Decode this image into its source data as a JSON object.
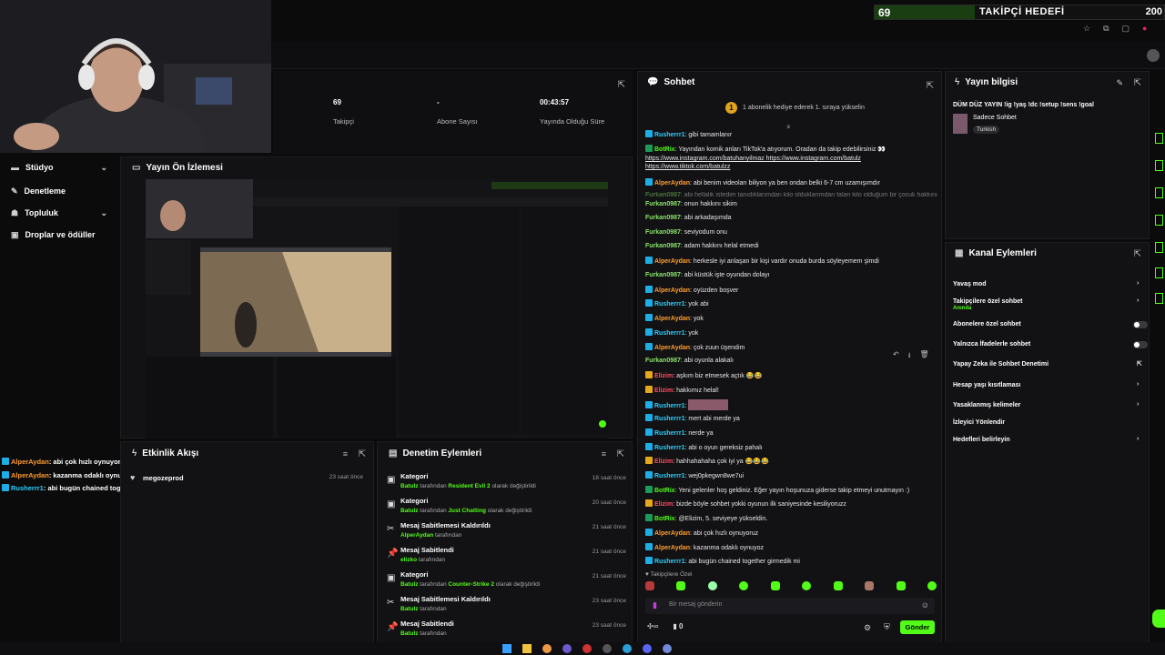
{
  "goal": {
    "current": "69",
    "label": "TAKİPÇİ HEDEFİ",
    "target": "200",
    "progress": 0.345
  },
  "sidebar": {
    "items": [
      {
        "label": "Stüdyo",
        "icon": "studio-icon",
        "has_chevron": true
      },
      {
        "label": "Denetleme",
        "icon": "wrench-icon",
        "has_chevron": false
      },
      {
        "label": "Topluluk",
        "icon": "community-icon",
        "has_chevron": true
      },
      {
        "label": "Droplar ve ödüller",
        "icon": "drops-icon",
        "has_chevron": false
      }
    ]
  },
  "stats": [
    {
      "value": "69",
      "label": "Takipçi"
    },
    {
      "value": "-",
      "label": "Abone Sayısı"
    },
    {
      "value": "00:43:57",
      "label": "Yayında Olduğu Süre"
    }
  ],
  "preview": {
    "title": "Yayın Ön İzlemesi"
  },
  "activity": {
    "title": "Etkinlik Akışı",
    "items": [
      {
        "name": "megozeprod",
        "time": "23 saat önce"
      }
    ]
  },
  "modactions": {
    "title": "Denetim Eylemleri",
    "items": [
      {
        "title": "Kategori",
        "by": "Batulz",
        "mid": " tarafından ",
        "hl": "Resident Evil 2",
        "tail": " olarak değiştirildi",
        "time": "18 saat önce",
        "icon": "category-icon"
      },
      {
        "title": "Kategori",
        "by": "Batulz",
        "mid": " tarafından ",
        "hl": "Just Chatting",
        "tail": " olarak değiştirildi",
        "time": "20 saat önce",
        "icon": "category-icon"
      },
      {
        "title": "Mesaj Sabitlemesi Kaldırıldı",
        "by": "AlperAydan",
        "mid": " tarafından",
        "hl": "",
        "tail": "",
        "time": "21 saat önce",
        "icon": "unpin-icon"
      },
      {
        "title": "Mesaj Sabitlendi",
        "by": "elizko",
        "mid": " tarafından",
        "hl": "",
        "tail": "",
        "time": "21 saat önce",
        "icon": "pin-icon"
      },
      {
        "title": "Kategori",
        "by": "Batulz",
        "mid": " tarafından ",
        "hl": "Counter-Strike 2",
        "tail": " olarak değiştirildi",
        "time": "21 saat önce",
        "icon": "category-icon"
      },
      {
        "title": "Mesaj Sabitlemesi Kaldırıldı",
        "by": "Batulz",
        "mid": " tarafından",
        "hl": "",
        "tail": "",
        "time": "23 saat önce",
        "icon": "unpin-icon"
      },
      {
        "title": "Mesaj Sabitlendi",
        "by": "Batulz",
        "mid": " tarafından",
        "hl": "",
        "tail": "",
        "time": "23 saat önce",
        "icon": "pin-icon"
      }
    ]
  },
  "chat": {
    "title": "Sohbet",
    "banner": "1 abonelik hediye ederek 1. sıraya yükselin",
    "banner_num": "1",
    "messages": [
      {
        "u": "Rusherrr1",
        "c": "u-c",
        "b": "b-mod",
        "t": ": gibi tamamlanır"
      },
      {
        "u": "BotRix",
        "c": "u-g",
        "b": "b-bot",
        "t": ": Yayından komik anları TikTok'a atıyorum. Oradan da takip edebilirsiniz 👀"
      },
      {
        "u": "",
        "c": "",
        "b": "",
        "t": "https://www.instagram.com/batuhanyilmaz https://www.instagram.com/batulz"
      },
      {
        "u": "",
        "c": "",
        "b": "",
        "t": "https://www.tiktok.com/batulzz"
      },
      {
        "u": "AlperAydan",
        "c": "u-o",
        "b": "b-mod",
        "t": ": abi benim videoları biliyon ya ben ondan belki 6-7 cm uzamışımdır"
      },
      {
        "u": "Furkan0987",
        "c": "u-l",
        "b": "",
        "t": ": abi hellalik istedim tanıdıklarımdan kilo olduklarımdan falan kilo olduğum bir çocuk hakkını"
      },
      {
        "u": "Furkan0987",
        "c": "u-l",
        "b": "",
        "t": ": onun hakkını sikim"
      },
      {
        "u": "Furkan0987",
        "c": "u-l",
        "b": "",
        "t": ": abi arkadaşımda"
      },
      {
        "u": "Furkan0987",
        "c": "u-l",
        "b": "",
        "t": ": seviyodum onu"
      },
      {
        "u": "Furkan0987",
        "c": "u-l",
        "b": "",
        "t": ": adam hakkını helal etmedi"
      },
      {
        "u": "AlperAydan",
        "c": "u-o",
        "b": "b-mod",
        "t": ": herkesle iyi anlaşan bir kişi vardır onuda burda söyleyemem şimdi"
      },
      {
        "u": "Furkan0987",
        "c": "u-l",
        "b": "",
        "t": ": abi küstük işte oyundan dolayı"
      },
      {
        "u": "AlperAydan",
        "c": "u-o",
        "b": "b-mod",
        "t": ": oyüzden boşver"
      },
      {
        "u": "Rusherrr1",
        "c": "u-c",
        "b": "b-mod",
        "t": ": yok abi"
      },
      {
        "u": "AlperAydan",
        "c": "u-o",
        "b": "b-mod",
        "t": ": yok"
      },
      {
        "u": "Rusherrr1",
        "c": "u-c",
        "b": "b-mod",
        "t": ": yok"
      },
      {
        "u": "AlperAydan",
        "c": "u-o",
        "b": "b-mod",
        "t": ": çok zuun üşendim"
      },
      {
        "u": "Furkan0987",
        "c": "u-l",
        "b": "",
        "t": ": abi oyunla alakalı"
      },
      {
        "u": "Elizim",
        "c": "u-r",
        "b": "b-vip",
        "t": ": aşkım biz etmesek açtık 😂😂"
      },
      {
        "u": "Elizim",
        "c": "u-r",
        "b": "b-vip",
        "t": ": hakkımız helal!"
      },
      {
        "u": "Rusherrr1",
        "c": "u-c",
        "b": "b-mod",
        "t": ": "
      },
      {
        "u": "Rusherrr1",
        "c": "u-c",
        "b": "b-mod",
        "t": ": mert abi merde ya"
      },
      {
        "u": "Rusherrr1",
        "c": "u-c",
        "b": "b-mod",
        "t": ": nerde ya"
      },
      {
        "u": "Rusherrr1",
        "c": "u-c",
        "b": "b-mod",
        "t": ": abi o oyun gereksiz pahalı"
      },
      {
        "u": "Elizim",
        "c": "u-r",
        "b": "b-vip",
        "t": ": hahhahahaha çok iyi ya 😂😂😂"
      },
      {
        "u": "Rusherrr1",
        "c": "u-c",
        "b": "b-mod",
        "t": ": wej0pkegwn8we7ui"
      },
      {
        "u": "BotRix",
        "c": "u-g",
        "b": "b-bot",
        "t": ": Yeni gelenler hoş geldiniz. Eğer yayın hoşunuza giderse takip etmeyi unutmayın :)"
      },
      {
        "u": "Elizim",
        "c": "u-r",
        "b": "b-vip",
        "t": ": bizde böyle sohbet yokki oyunun ilk saniyesinde kesiliyoruzz"
      },
      {
        "u": "BotRix",
        "c": "u-g",
        "b": "b-bot",
        "t": ": @Elizim, 5. seviyeye yükseldin."
      },
      {
        "u": "AlperAydan",
        "c": "u-o",
        "b": "b-mod",
        "t": ": abi çok hızlı oynuyoruz"
      },
      {
        "u": "AlperAydan",
        "c": "u-o",
        "b": "b-mod",
        "t": ": kazanma odaklı oynuyoz"
      },
      {
        "u": "Rusherrr1",
        "c": "u-c",
        "b": "b-mod",
        "t": ": abi bugün chained together girmedik mi"
      }
    ],
    "followers_only": "Takipçilere Özel",
    "input_placeholder": "Bir mesaj gönderin",
    "count": "0",
    "send": "Gönder"
  },
  "streaminfo": {
    "title": "Yayın bilgisi",
    "stream_title": "DÜM DÜZ YAYIN !ig !yaş !dc !setup !sens !goal",
    "category": "Sadece Sohbet",
    "tag": "Turkish"
  },
  "chanactions": {
    "title": "Kanal Eylemleri",
    "items": [
      {
        "label": "Yavaş mod",
        "kind": "chev",
        "sub": ""
      },
      {
        "label": "Takipçilere özel sohbet",
        "kind": "chev",
        "sub": "Anında"
      },
      {
        "label": "Abonelere özel sohbet",
        "kind": "toggle",
        "sub": ""
      },
      {
        "label": "Yalnızca İfadelerle sohbet",
        "kind": "toggle",
        "sub": ""
      },
      {
        "label": "Yapay Zeka ile Sohbet Denetimi",
        "kind": "ext",
        "sub": ""
      },
      {
        "label": "Hesap yaşı kısıtlaması",
        "kind": "chev",
        "sub": ""
      },
      {
        "label": "Yasaklanmış kelimeler",
        "kind": "chev",
        "sub": ""
      },
      {
        "label": "İzleyici Yönlendir",
        "kind": "none",
        "sub": ""
      },
      {
        "label": "Hedefleri belirleyin",
        "kind": "chev",
        "sub": ""
      }
    ]
  },
  "overlay_chat": [
    {
      "u": "AlperAydan",
      "c": "#ff9d2e",
      "t": ": abi çok hızlı oynuyoruz"
    },
    {
      "u": "AlperAydan",
      "c": "#ff9d2e",
      "t": ": kazanma odaklı oynuyoz"
    },
    {
      "u": "Rusherrr1",
      "c": "#2ed0ff",
      "t": ": abi bugün chained together girmedik mi"
    }
  ]
}
